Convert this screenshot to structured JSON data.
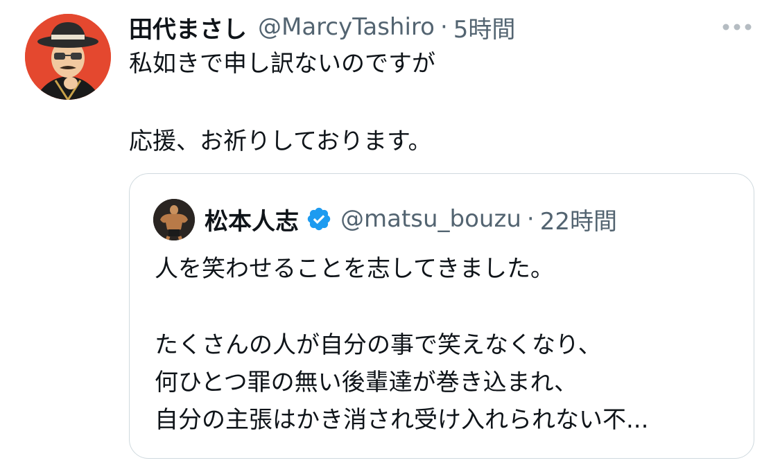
{
  "tweet": {
    "author_name": "田代まさし",
    "author_handle": "@MarcyTashiro",
    "separator": "·",
    "timestamp": "5時間",
    "text_line1": "私如きで申し訳ないのですが",
    "text_line2": "応援、お祈りしております。"
  },
  "quoted_tweet": {
    "author_name": "松本人志",
    "verified": true,
    "author_handle": "@matsu_bouzu",
    "separator": "·",
    "timestamp": "22時間",
    "lines": [
      "人を笑わせることを志してきました。",
      "たくさんの人が自分の事で笑えなくなり、",
      "何ひとつ罪の無い後輩達が巻き込まれ、",
      "自分の主張はかき消され受け入れられない不..."
    ]
  },
  "colors": {
    "text_primary": "#0f1419",
    "text_secondary": "#536471",
    "border": "#cfd9de",
    "verified_blue": "#1d9bf0",
    "avatar_bg": "#e4482f"
  },
  "icons": {
    "more": "more-horizontal-icon",
    "verified": "verified-badge-icon"
  }
}
